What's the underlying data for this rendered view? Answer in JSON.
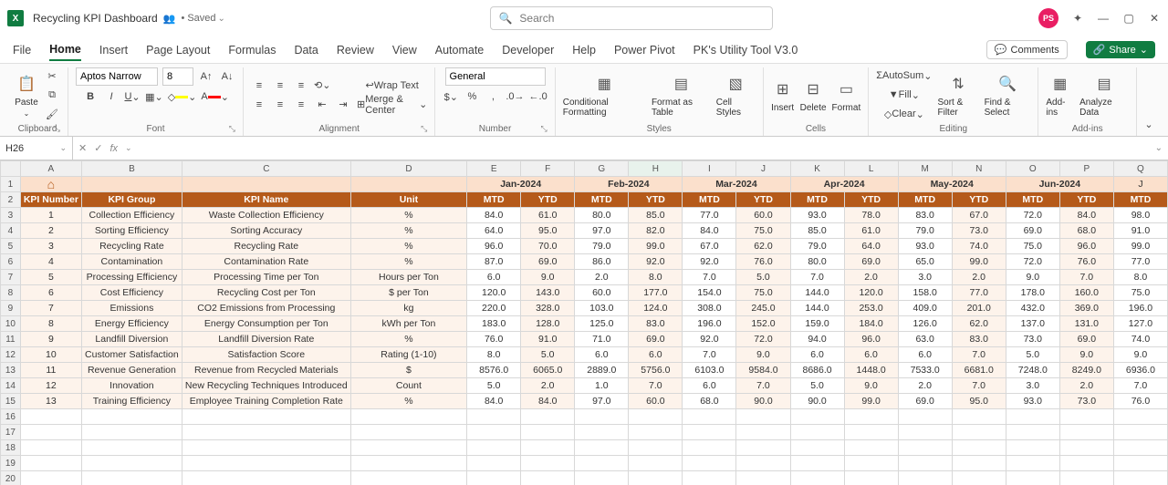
{
  "titlebar": {
    "app_initial": "X",
    "doc_title": "Recycling KPI Dashboard",
    "saved_indicator": "• Saved",
    "search_placeholder": "Search",
    "avatar_text": "PS"
  },
  "ribbon_tabs": {
    "file": "File",
    "home": "Home",
    "insert": "Insert",
    "page_layout": "Page Layout",
    "formulas": "Formulas",
    "data": "Data",
    "review": "Review",
    "view": "View",
    "automate": "Automate",
    "developer": "Developer",
    "help": "Help",
    "power_pivot": "Power Pivot",
    "utility": "PK's Utility Tool V3.0",
    "comments": "Comments",
    "share": "Share"
  },
  "ribbon": {
    "clipboard": {
      "paste": "Paste",
      "label": "Clipboard"
    },
    "font": {
      "name": "Aptos Narrow",
      "size": "8",
      "label": "Font"
    },
    "alignment": {
      "wrap": "Wrap Text",
      "merge": "Merge & Center",
      "label": "Alignment"
    },
    "number": {
      "format": "General",
      "label": "Number"
    },
    "styles": {
      "cond": "Conditional Formatting",
      "table": "Format as Table",
      "cell": "Cell Styles",
      "label": "Styles"
    },
    "cells": {
      "insert": "Insert",
      "delete": "Delete",
      "format": "Format",
      "label": "Cells"
    },
    "editing": {
      "autosum": "AutoSum",
      "fill": "Fill",
      "clear": "Clear",
      "sort": "Sort & Filter",
      "find": "Find & Select",
      "label": "Editing"
    },
    "addins": {
      "addins": "Add-ins",
      "analyze": "Analyze Data",
      "label": "Add-ins"
    }
  },
  "formula": {
    "name_box": "H26",
    "fx": "fx"
  },
  "sheet": {
    "col_letters": [
      "A",
      "B",
      "C",
      "D",
      "E",
      "F",
      "G",
      "H",
      "I",
      "J",
      "K",
      "L",
      "M",
      "N",
      "O",
      "P",
      "Q"
    ],
    "months": [
      "Jan-2024",
      "Feb-2024",
      "Mar-2024",
      "Apr-2024",
      "May-2024",
      "Jun-2024"
    ],
    "hdr": {
      "kpi_num": "KPI Number",
      "kpi_group": "KPI Group",
      "kpi_name": "KPI Name",
      "unit": "Unit",
      "mtd": "MTD",
      "ytd": "YTD"
    },
    "rows": [
      {
        "n": "1",
        "g": "Collection Efficiency",
        "k": "Waste Collection Efficiency",
        "u": "%",
        "v": [
          "84.0",
          "61.0",
          "80.0",
          "85.0",
          "77.0",
          "60.0",
          "93.0",
          "78.0",
          "83.0",
          "67.0",
          "72.0",
          "84.0",
          "98.0"
        ]
      },
      {
        "n": "2",
        "g": "Sorting Efficiency",
        "k": "Sorting Accuracy",
        "u": "%",
        "v": [
          "64.0",
          "95.0",
          "97.0",
          "82.0",
          "84.0",
          "75.0",
          "85.0",
          "61.0",
          "79.0",
          "73.0",
          "69.0",
          "68.0",
          "91.0"
        ]
      },
      {
        "n": "3",
        "g": "Recycling Rate",
        "k": "Recycling Rate",
        "u": "%",
        "v": [
          "96.0",
          "70.0",
          "79.0",
          "99.0",
          "67.0",
          "62.0",
          "79.0",
          "64.0",
          "93.0",
          "74.0",
          "75.0",
          "96.0",
          "99.0"
        ]
      },
      {
        "n": "4",
        "g": "Contamination",
        "k": "Contamination Rate",
        "u": "%",
        "v": [
          "87.0",
          "69.0",
          "86.0",
          "92.0",
          "92.0",
          "76.0",
          "80.0",
          "69.0",
          "65.0",
          "99.0",
          "72.0",
          "76.0",
          "77.0"
        ]
      },
      {
        "n": "5",
        "g": "Processing Efficiency",
        "k": "Processing Time per Ton",
        "u": "Hours per Ton",
        "v": [
          "6.0",
          "9.0",
          "2.0",
          "8.0",
          "7.0",
          "5.0",
          "7.0",
          "2.0",
          "3.0",
          "2.0",
          "9.0",
          "7.0",
          "8.0"
        ]
      },
      {
        "n": "6",
        "g": "Cost Efficiency",
        "k": "Recycling Cost per Ton",
        "u": "$ per Ton",
        "v": [
          "120.0",
          "143.0",
          "60.0",
          "177.0",
          "154.0",
          "75.0",
          "144.0",
          "120.0",
          "158.0",
          "77.0",
          "178.0",
          "160.0",
          "75.0"
        ]
      },
      {
        "n": "7",
        "g": "Emissions",
        "k": "CO2 Emissions from Processing",
        "u": "kg",
        "v": [
          "220.0",
          "328.0",
          "103.0",
          "124.0",
          "308.0",
          "245.0",
          "144.0",
          "253.0",
          "409.0",
          "201.0",
          "432.0",
          "369.0",
          "196.0"
        ]
      },
      {
        "n": "8",
        "g": "Energy Efficiency",
        "k": "Energy Consumption per Ton",
        "u": "kWh per Ton",
        "v": [
          "183.0",
          "128.0",
          "125.0",
          "83.0",
          "196.0",
          "152.0",
          "159.0",
          "184.0",
          "126.0",
          "62.0",
          "137.0",
          "131.0",
          "127.0"
        ]
      },
      {
        "n": "9",
        "g": "Landfill Diversion",
        "k": "Landfill Diversion Rate",
        "u": "%",
        "v": [
          "76.0",
          "91.0",
          "71.0",
          "69.0",
          "92.0",
          "72.0",
          "94.0",
          "96.0",
          "63.0",
          "83.0",
          "73.0",
          "69.0",
          "74.0"
        ]
      },
      {
        "n": "10",
        "g": "Customer Satisfaction",
        "k": "Satisfaction Score",
        "u": "Rating (1-10)",
        "v": [
          "8.0",
          "5.0",
          "6.0",
          "6.0",
          "7.0",
          "9.0",
          "6.0",
          "6.0",
          "6.0",
          "7.0",
          "5.0",
          "9.0",
          "9.0"
        ]
      },
      {
        "n": "11",
        "g": "Revenue Generation",
        "k": "Revenue from Recycled Materials",
        "u": "$",
        "v": [
          "8576.0",
          "6065.0",
          "2889.0",
          "5756.0",
          "6103.0",
          "9584.0",
          "8686.0",
          "1448.0",
          "7533.0",
          "6681.0",
          "7248.0",
          "8249.0",
          "6936.0"
        ]
      },
      {
        "n": "12",
        "g": "Innovation",
        "k": "New Recycling Techniques Introduced",
        "u": "Count",
        "v": [
          "5.0",
          "2.0",
          "1.0",
          "7.0",
          "6.0",
          "7.0",
          "5.0",
          "9.0",
          "2.0",
          "7.0",
          "3.0",
          "2.0",
          "7.0"
        ]
      },
      {
        "n": "13",
        "g": "Training Efficiency",
        "k": "Employee Training Completion Rate",
        "u": "%",
        "v": [
          "84.0",
          "84.0",
          "97.0",
          "60.0",
          "68.0",
          "90.0",
          "90.0",
          "99.0",
          "69.0",
          "95.0",
          "93.0",
          "73.0",
          "76.0"
        ]
      }
    ]
  }
}
